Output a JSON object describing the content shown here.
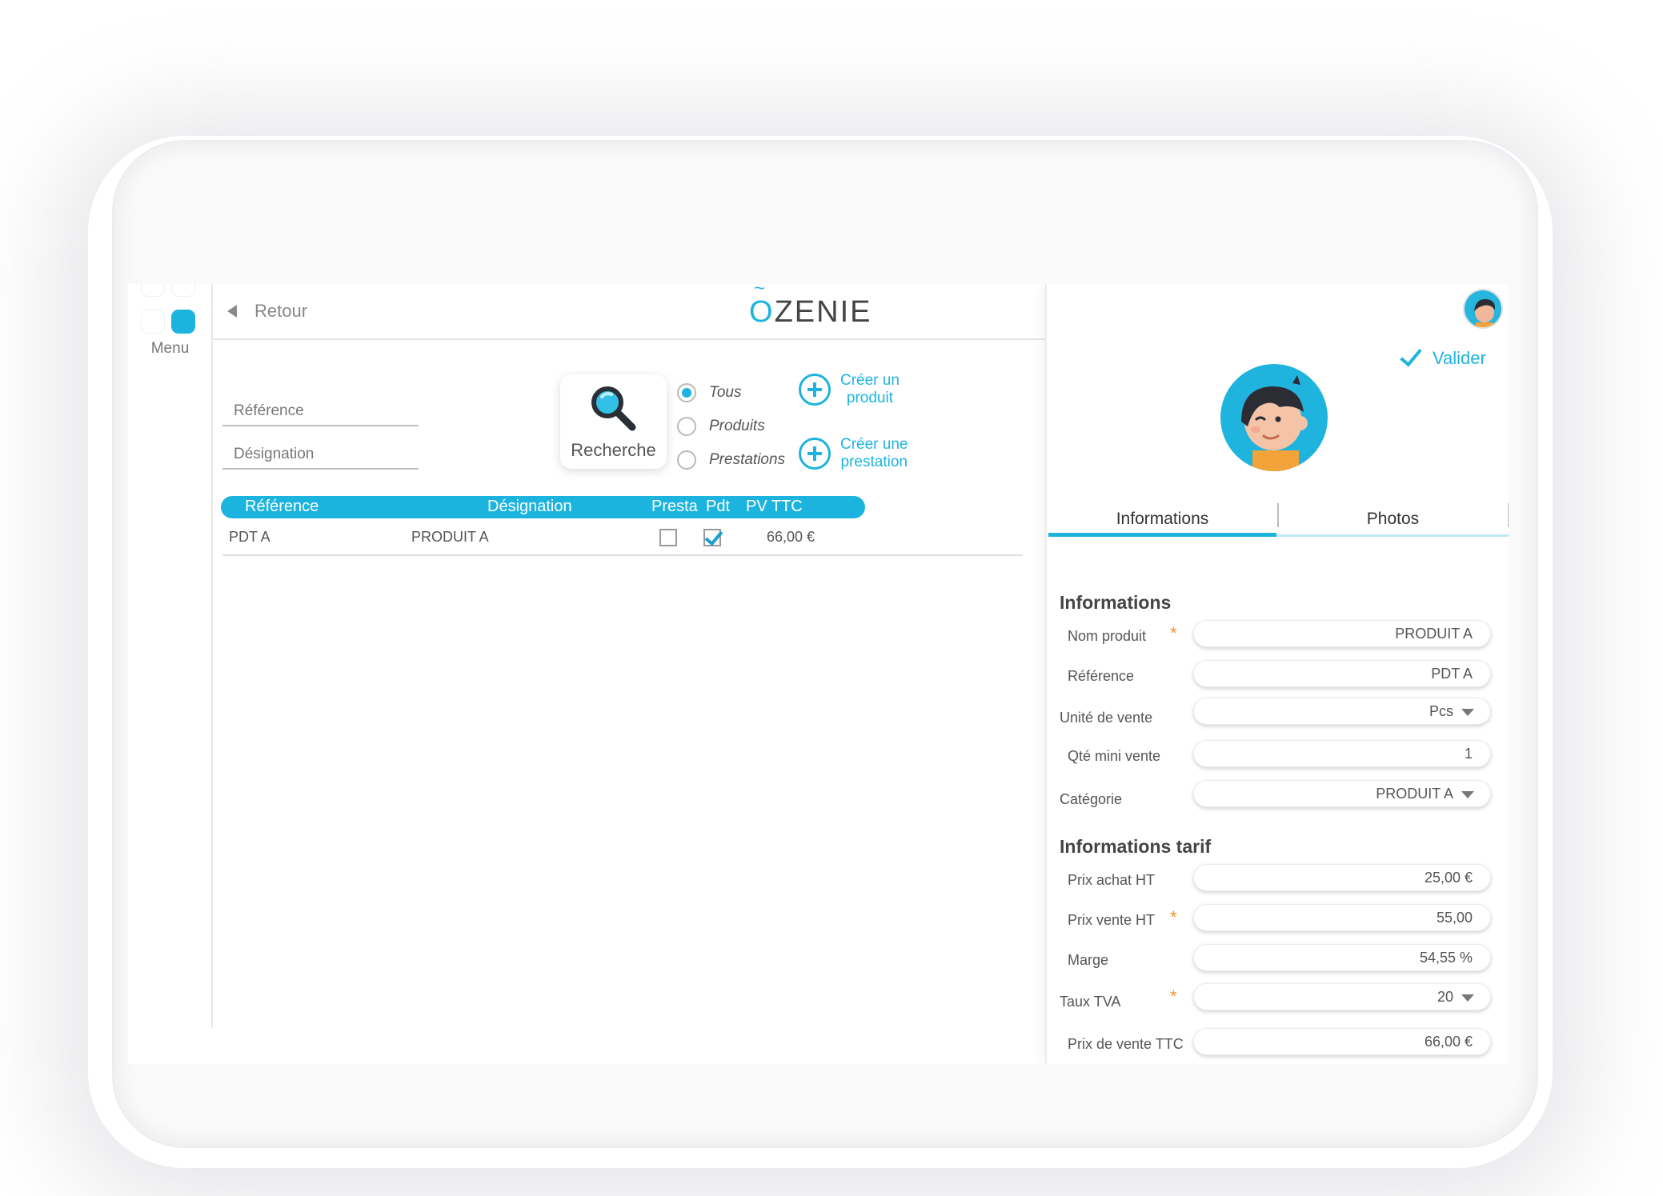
{
  "menu": {
    "label": "Menu"
  },
  "topbar": {
    "back_label": "Retour",
    "logo_o": "O",
    "logo_rest": "ZENIE"
  },
  "search": {
    "reference_placeholder": "Référence",
    "designation_placeholder": "Désignation",
    "button_label": "Recherche",
    "filters": [
      {
        "label": "Tous",
        "selected": true
      },
      {
        "label": "Produits",
        "selected": false
      },
      {
        "label": "Prestations",
        "selected": false
      }
    ],
    "create_product": "Créer un\nproduit",
    "create_service": "Créer une\nprestation"
  },
  "table": {
    "headers": {
      "reference": "Référence",
      "designation": "Désignation",
      "presta": "Presta",
      "pdt": "Pdt",
      "pv_ttc": "PV TTC"
    },
    "rows": [
      {
        "reference": "PDT A",
        "designation": "PRODUIT A",
        "presta": false,
        "pdt": true,
        "pv_ttc": "66,00 €"
      }
    ]
  },
  "panel": {
    "validate_label": "Valider",
    "tabs": [
      {
        "label": "Informations",
        "active": true
      },
      {
        "label": "Photos",
        "active": false
      }
    ],
    "section_info": "Informations",
    "section_tarif": "Informations tarif",
    "fields": {
      "nom_produit": {
        "label": "Nom produit",
        "value": "PRODUIT A",
        "required": "*"
      },
      "reference": {
        "label": "Référence",
        "value": "PDT A"
      },
      "unite_vente": {
        "label": "Unité de vente",
        "value": "Pcs"
      },
      "qte_mini": {
        "label": "Qté mini vente",
        "value": "1"
      },
      "categorie": {
        "label": "Catégorie",
        "value": "PRODUIT A"
      },
      "prix_achat": {
        "label": "Prix achat HT",
        "value": "25,00 €"
      },
      "prix_vente_ht": {
        "label": "Prix vente HT",
        "value": "55,00",
        "required": "*"
      },
      "marge": {
        "label": "Marge",
        "value": "54,55 %"
      },
      "taux_tva": {
        "label": "Taux TVA",
        "value": "20",
        "required": "*"
      },
      "prix_ttc": {
        "label": "Prix de vente TTC",
        "value": "66,00 €"
      }
    }
  },
  "colors": {
    "accent": "#1cb4df",
    "required": "#f2962b",
    "text": "#555555"
  }
}
